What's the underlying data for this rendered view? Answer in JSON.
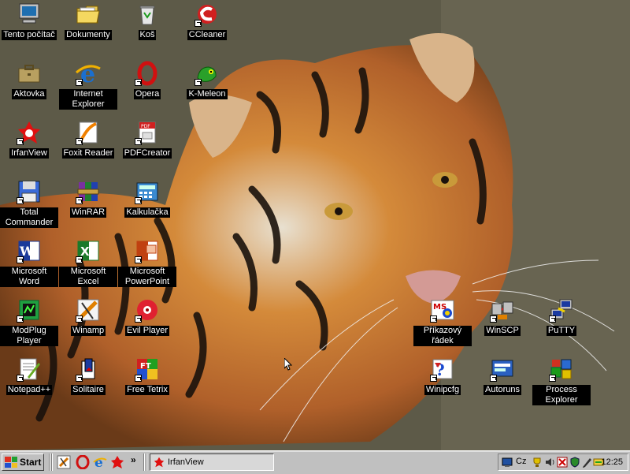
{
  "desktop": {
    "icons": [
      {
        "label": "Tento počítač",
        "icon": "my-computer-icon"
      },
      {
        "label": "Dokumenty",
        "icon": "documents-folder-icon"
      },
      {
        "label": "Koš",
        "icon": "recycle-bin-icon"
      },
      {
        "label": "CCleaner",
        "icon": "ccleaner-icon"
      },
      {
        "label": "Aktovka",
        "icon": "briefcase-icon"
      },
      {
        "label": "Internet Explorer",
        "icon": "internet-explorer-icon"
      },
      {
        "label": "Opera",
        "icon": "opera-icon"
      },
      {
        "label": "K-Meleon",
        "icon": "k-meleon-icon"
      },
      {
        "label": "IrfanView",
        "icon": "irfanview-icon"
      },
      {
        "label": "Foxit Reader",
        "icon": "foxit-reader-icon"
      },
      {
        "label": "PDFCreator",
        "icon": "pdfcreator-icon"
      },
      {
        "label": "Total Commander",
        "icon": "total-commander-icon"
      },
      {
        "label": "WinRAR",
        "icon": "winrar-icon"
      },
      {
        "label": "Kalkulačka",
        "icon": "calculator-icon"
      },
      {
        "label": "Microsoft Word",
        "icon": "word-icon"
      },
      {
        "label": "Microsoft Excel",
        "icon": "excel-icon"
      },
      {
        "label": "Microsoft PowerPoint",
        "icon": "powerpoint-icon"
      },
      {
        "label": "ModPlug Player",
        "icon": "modplug-icon"
      },
      {
        "label": "Winamp",
        "icon": "winamp-icon"
      },
      {
        "label": "Evil Player",
        "icon": "evil-player-icon"
      },
      {
        "label": "Notepad++",
        "icon": "notepadpp-icon"
      },
      {
        "label": "Solitaire",
        "icon": "solitaire-icon"
      },
      {
        "label": "Free Tetrix",
        "icon": "free-tetrix-icon"
      },
      {
        "label": "Příkazový řádek",
        "icon": "command-prompt-icon"
      },
      {
        "label": "WinSCP",
        "icon": "winscp-icon"
      },
      {
        "label": "PuTTY",
        "icon": "putty-icon"
      },
      {
        "label": "Winipcfg",
        "icon": "winipcfg-icon"
      },
      {
        "label": "Autoruns",
        "icon": "autoruns-icon"
      },
      {
        "label": "Process Explorer",
        "icon": "process-explorer-icon"
      }
    ]
  },
  "taskbar": {
    "start_label": "Start",
    "quicklaunch": [
      "winamp-icon",
      "opera-icon",
      "internet-explorer-icon",
      "irfanview-icon"
    ],
    "chevron": "»",
    "tasks": [
      {
        "label": "IrfanView",
        "icon": "irfanview-icon"
      }
    ],
    "tray": {
      "language": "Cz",
      "time": "12:25"
    }
  },
  "colors": {
    "taskbar": "#c0c0c0",
    "label_bg": "#000000",
    "label_fg": "#ffffff"
  }
}
